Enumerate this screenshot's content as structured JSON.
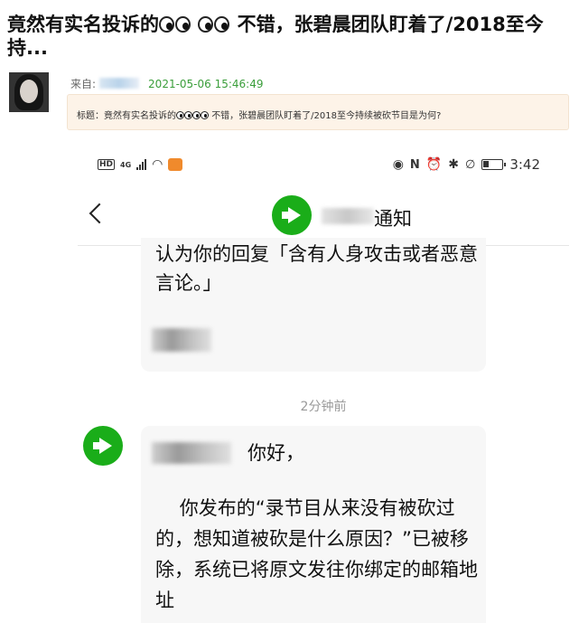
{
  "article": {
    "headline_part1": "竟然有实名投诉的",
    "headline_part2": "不错，张碧晨团队盯着了/2018至今持...",
    "meta_from": "来自:",
    "meta_time": "2021-05-06 15:46:49",
    "subject_part1": "标题：竟然有实名投诉的",
    "subject_part2": "不错，张碧晨团队盯着了/2018至今持续被砍节目是为何?"
  },
  "phone": {
    "status_time": "3:42",
    "network": "4G",
    "hd_label": "HD",
    "nav_title": "通知",
    "message1_text": "认为你的回复「含有人身攻击或者恶意言论。」",
    "time_separator": "2分钟前",
    "message2_greeting": "你好，",
    "message2_body": "    你发布的“录节目从来没有被砍过的，想知道被砍是什么原因？”已被移除，系统已将原文发往你绑定的邮箱地址"
  },
  "colors": {
    "accent_green": "#1aad19",
    "timestamp_green": "#3a9e3a",
    "subject_bg": "#fdf3e8"
  },
  "icons": [
    "eyes-emoji-icon",
    "back-arrow-icon",
    "megaphone-icon",
    "signal-icon",
    "wifi-icon",
    "eye-icon",
    "nfc-icon",
    "alarm-icon",
    "bluetooth-icon",
    "mute-icon",
    "battery-icon"
  ]
}
